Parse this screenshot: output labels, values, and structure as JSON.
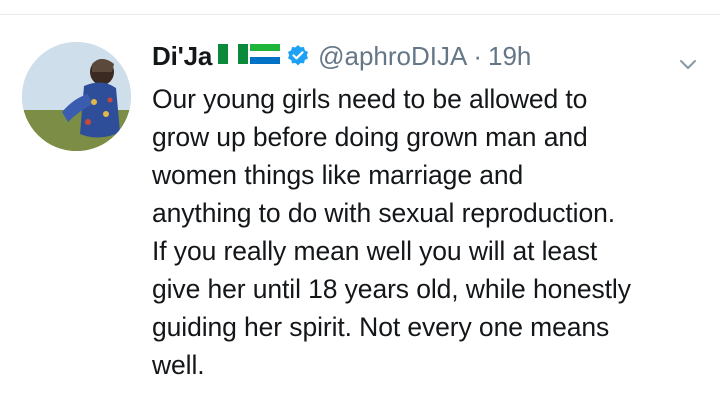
{
  "tweet": {
    "display_name": "Di'Ja",
    "handle": "@aphroDIJA",
    "separator": "·",
    "timestamp": "19h",
    "flags": [
      "nigeria-flag-icon",
      "sierra-leone-flag-icon"
    ],
    "verified_icon": "verified-badge-icon",
    "menu_icon": "chevron-down-icon",
    "text_lines": [
      "Our young girls need to be allowed to",
      "grow up before doing grown man and",
      "women things like marriage and",
      "anything to do with sexual reproduction.",
      "If you really mean well you will at least",
      "give her until 18 years old, while honestly",
      "guiding her spirit. Not every one means",
      "well."
    ]
  },
  "colors": {
    "text": "#14171a",
    "secondary": "#657786",
    "verified": "#1da1f2",
    "divider": "#e6ecf0"
  }
}
